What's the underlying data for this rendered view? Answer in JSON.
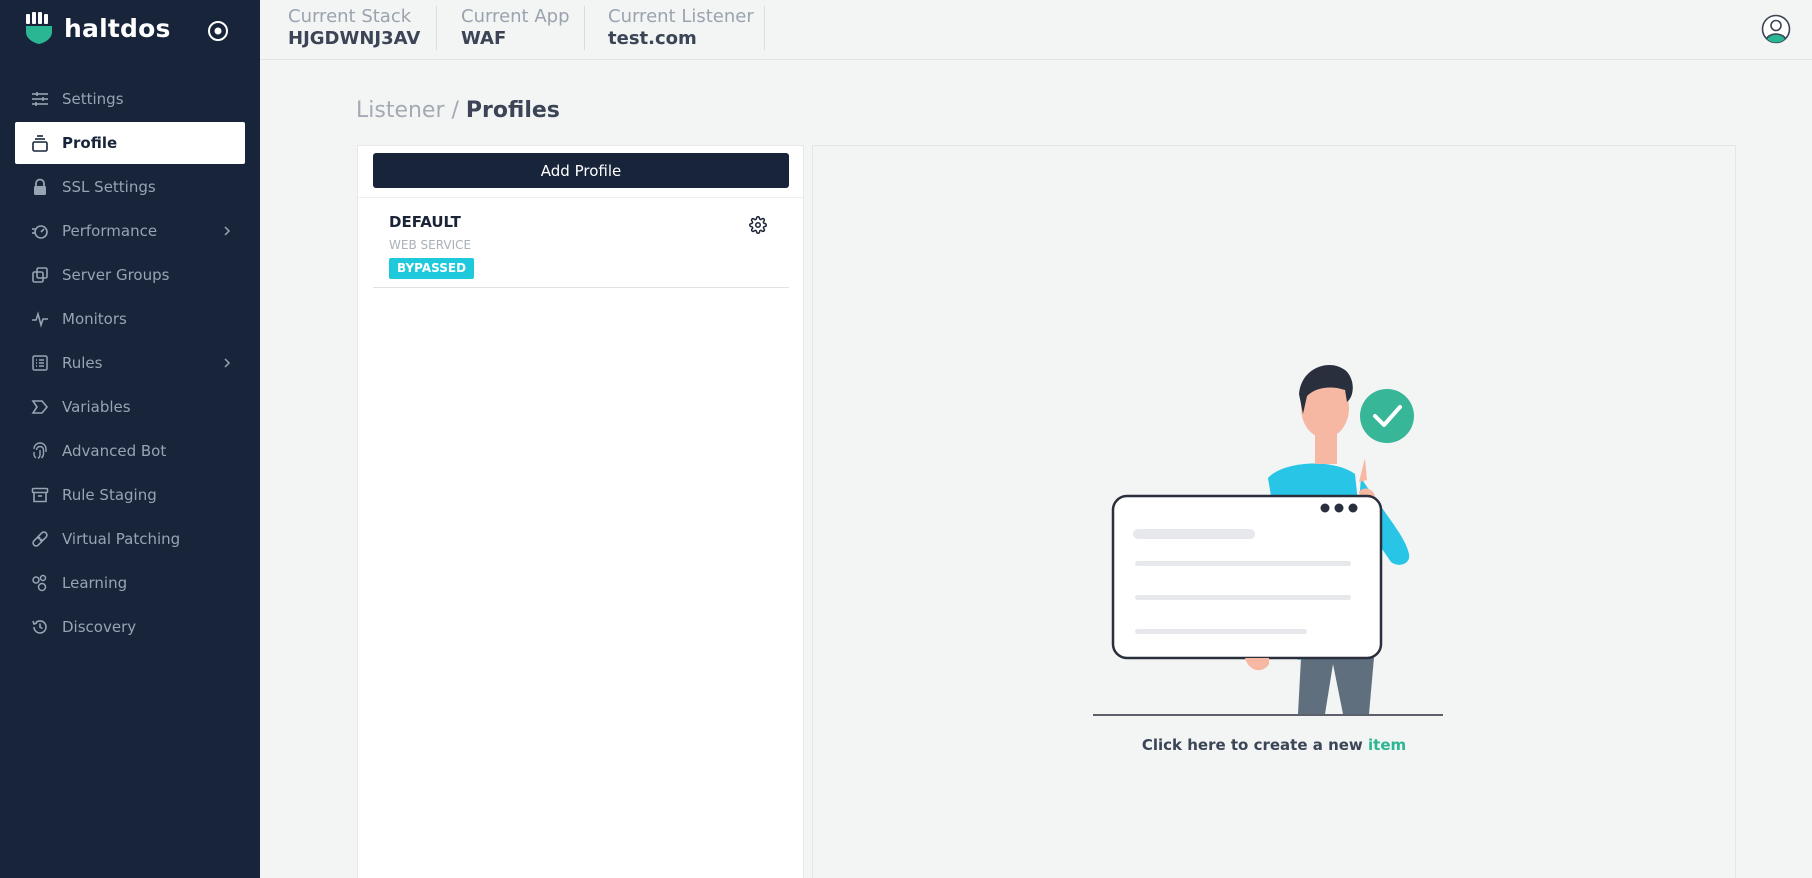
{
  "brand": {
    "name": "haltdos",
    "logo_icon": "haltdos-shield-icon",
    "accent": "#2bb693"
  },
  "sidebar": {
    "items": [
      {
        "label": "Settings",
        "icon": "sliders-icon",
        "active": false,
        "expandable": false
      },
      {
        "label": "Profile",
        "icon": "stack-icon",
        "active": true,
        "expandable": false
      },
      {
        "label": "SSL Settings",
        "icon": "lock-icon",
        "active": false,
        "expandable": false
      },
      {
        "label": "Performance",
        "icon": "speedometer-icon",
        "active": false,
        "expandable": true
      },
      {
        "label": "Server Groups",
        "icon": "copy-icon",
        "active": false,
        "expandable": false
      },
      {
        "label": "Monitors",
        "icon": "pulse-icon",
        "active": false,
        "expandable": false
      },
      {
        "label": "Rules",
        "icon": "list-icon",
        "active": false,
        "expandable": true
      },
      {
        "label": "Variables",
        "icon": "tag-icon",
        "active": false,
        "expandable": false
      },
      {
        "label": "Advanced Bot",
        "icon": "fingerprint-icon",
        "active": false,
        "expandable": false
      },
      {
        "label": "Rule Staging",
        "icon": "archive-icon",
        "active": false,
        "expandable": false
      },
      {
        "label": "Virtual Patching",
        "icon": "bandage-icon",
        "active": false,
        "expandable": false
      },
      {
        "label": "Learning",
        "icon": "molecule-icon",
        "active": false,
        "expandable": false
      },
      {
        "label": "Discovery",
        "icon": "history-icon",
        "active": false,
        "expandable": false
      }
    ]
  },
  "topbar": {
    "stack": {
      "label": "Current Stack",
      "value": "HJGDWNJ3AV"
    },
    "app": {
      "label": "Current App",
      "value": "WAF"
    },
    "listener": {
      "label": "Current Listener",
      "value": "test.com"
    }
  },
  "breadcrumb": {
    "parent": "Listener",
    "separator": " / ",
    "current": "Profiles"
  },
  "list": {
    "add_button": "Add Profile",
    "profiles": [
      {
        "name": "DEFAULT",
        "type": "WEB SERVICE",
        "status": "BYPASSED",
        "status_color": "#1fc9dc"
      }
    ]
  },
  "detail": {
    "cta_text": "Click here to create a new ",
    "cta_link": "item"
  }
}
